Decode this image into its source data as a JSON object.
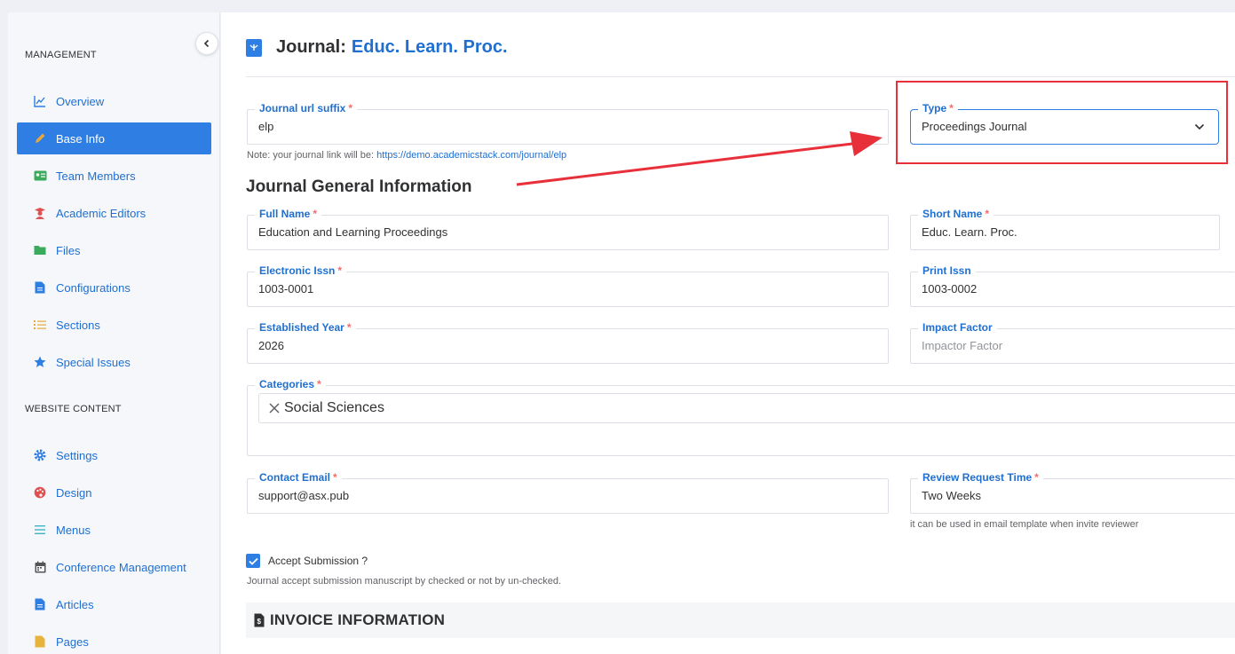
{
  "sidebar": {
    "collapse_icon": "chevron-left-icon",
    "management_title": "MANAGEMENT",
    "website_title": "WEBSITE CONTENT",
    "items": [
      {
        "label": "Overview",
        "icon": "line-chart-icon"
      },
      {
        "label": "Base Info",
        "icon": "pencil-icon",
        "active": true
      },
      {
        "label": "Team Members",
        "icon": "id-card-icon"
      },
      {
        "label": "Academic Editors",
        "icon": "graduate-icon"
      },
      {
        "label": "Files",
        "icon": "folder-icon"
      },
      {
        "label": "Configurations",
        "icon": "file-icon"
      },
      {
        "label": "Sections",
        "icon": "list-icon"
      },
      {
        "label": "Special Issues",
        "icon": "star-icon"
      },
      {
        "label": "Settings",
        "icon": "gear-icon"
      },
      {
        "label": "Design",
        "icon": "palette-icon"
      },
      {
        "label": "Menus",
        "icon": "menu-icon"
      },
      {
        "label": "Conference Management",
        "icon": "calendar-icon"
      },
      {
        "label": "Articles",
        "icon": "file-icon"
      },
      {
        "label": "Pages",
        "icon": "page-icon"
      }
    ]
  },
  "header": {
    "title_prefix": "Journal:",
    "title_name": "Educ. Learn. Proc."
  },
  "form": {
    "url_suffix": {
      "label": "Journal url suffix",
      "value": "elp"
    },
    "url_note_prefix": "Note: your journal link will be:",
    "url_note_link": "https://demo.academicstack.com/journal/elp",
    "type": {
      "label": "Type",
      "value": "Proceedings Journal"
    },
    "section_heading": "Journal General Information",
    "full_name": {
      "label": "Full Name",
      "value": "Education and Learning Proceedings"
    },
    "short_name": {
      "label": "Short Name",
      "value": "Educ. Learn. Proc."
    },
    "electronic_issn": {
      "label": "Electronic Issn",
      "value": "1003-0001"
    },
    "print_issn": {
      "label": "Print Issn",
      "value": "1003-0002"
    },
    "established_year": {
      "label": "Established Year",
      "value": "2026"
    },
    "impact_factor": {
      "label": "Impact Factor",
      "placeholder": "Impactor Factor"
    },
    "categories": {
      "label": "Categories",
      "tags": [
        "Social Sciences"
      ]
    },
    "contact_email": {
      "label": "Contact Email",
      "value": "support@asx.pub"
    },
    "review_time": {
      "label": "Review Request Time",
      "value": "Two Weeks"
    },
    "review_note": "it can be used in email template when invite reviewer",
    "accept_submission": {
      "label": "Accept Submission ?",
      "checked": true
    },
    "accept_note": "Journal accept submission manuscript by checked or not by un-checked.",
    "invoice_heading": "INVOICE INFORMATION"
  },
  "required_mark": "*",
  "colors": {
    "accent": "#2f7ee3",
    "link": "#1f6fd1",
    "required": "#f56c6c",
    "annotation": "#e8303a"
  }
}
